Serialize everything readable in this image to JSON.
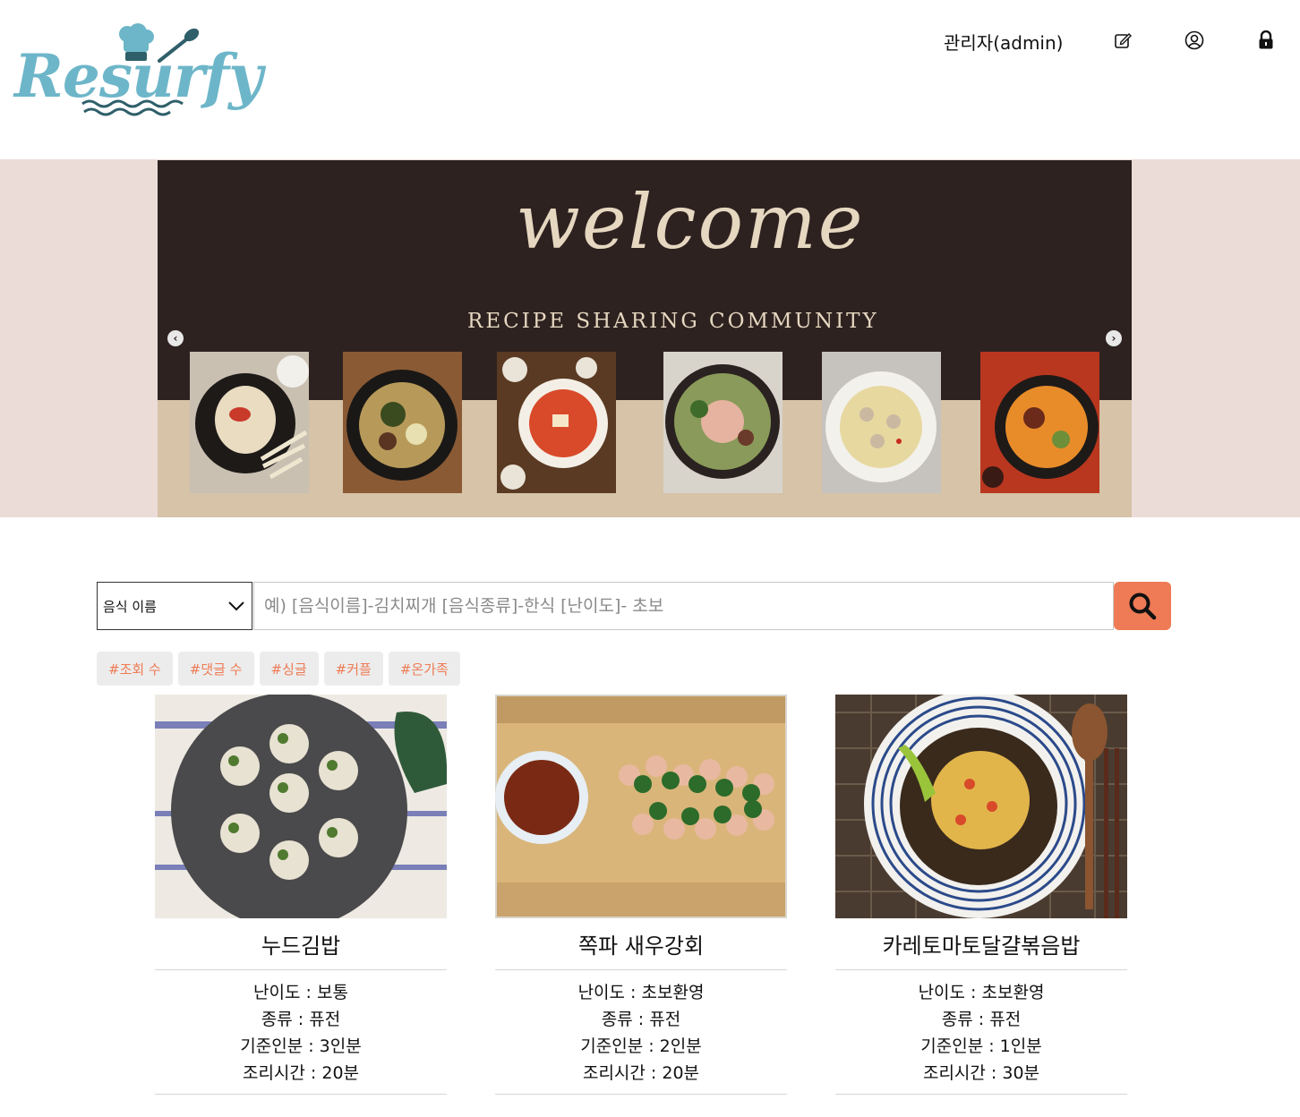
{
  "header": {
    "logo_text": "Resurfy",
    "admin_label": "관리자(admin)",
    "icons": [
      "edit-icon",
      "user-circle-icon",
      "lock-icon"
    ]
  },
  "banner": {
    "welcome": "welcome",
    "subtitle": "RECIPE SHARING COMMUNITY",
    "prev_arrow": "‹",
    "next_arrow": "›",
    "colors": {
      "dark": "#2e2220",
      "beige": "#d6c3a8",
      "band": "#ecdcd8",
      "text": "#e6d7c0"
    }
  },
  "search": {
    "select_value": "음식 이름",
    "placeholder": "예) [음식이름]-김치찌개 [음식종류]-한식 [난이도]- 초보",
    "button_color": "#ee7b55"
  },
  "tags": [
    "#조회 수",
    "#댓글 수",
    "#싱글",
    "#커플",
    "#온가족"
  ],
  "cards": [
    {
      "title": "누드김밥",
      "difficulty": "난이도 : 보통",
      "category": "종류 : 퓨전",
      "servings": "기준인분 : 3인분",
      "time": "조리시간 : 20분"
    },
    {
      "title": "쪽파 새우강회",
      "difficulty": "난이도 : 초보환영",
      "category": "종류 : 퓨전",
      "servings": "기준인분 : 2인분",
      "time": "조리시간 : 20분"
    },
    {
      "title": "카레토마토달걀볶음밥",
      "difficulty": "난이도 : 초보환영",
      "category": "종류 : 퓨전",
      "servings": "기준인분 : 1인분",
      "time": "조리시간 : 30분"
    }
  ]
}
